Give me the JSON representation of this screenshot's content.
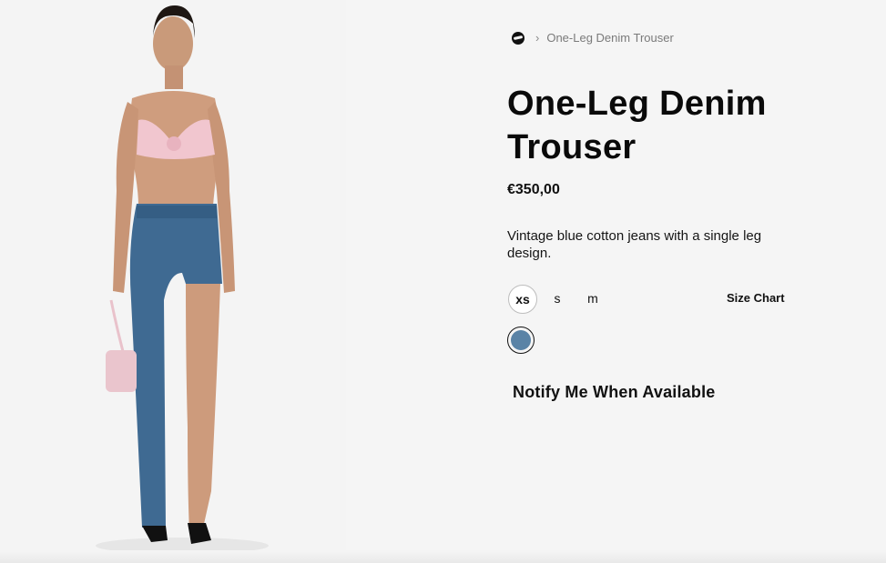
{
  "breadcrumb": {
    "home_icon": "brand-logo-icon",
    "separator": "›",
    "current": "One-Leg Denim Trouser"
  },
  "product": {
    "title_line1": "One-Leg Denim",
    "title_line2": "Trouser",
    "price": "€350,00",
    "description": "Vintage blue cotton jeans with a single leg design.",
    "sizes": [
      "xs",
      "s",
      "m"
    ],
    "selected_size": "xs",
    "size_chart_label": "Size Chart",
    "color_swatch": "#5a83a6",
    "notify_label": "Notify Me When Available"
  },
  "colors": {
    "background": "#f5f5f5",
    "text": "#111111",
    "muted": "#7a7a7a",
    "denim": "#3f6a92"
  }
}
